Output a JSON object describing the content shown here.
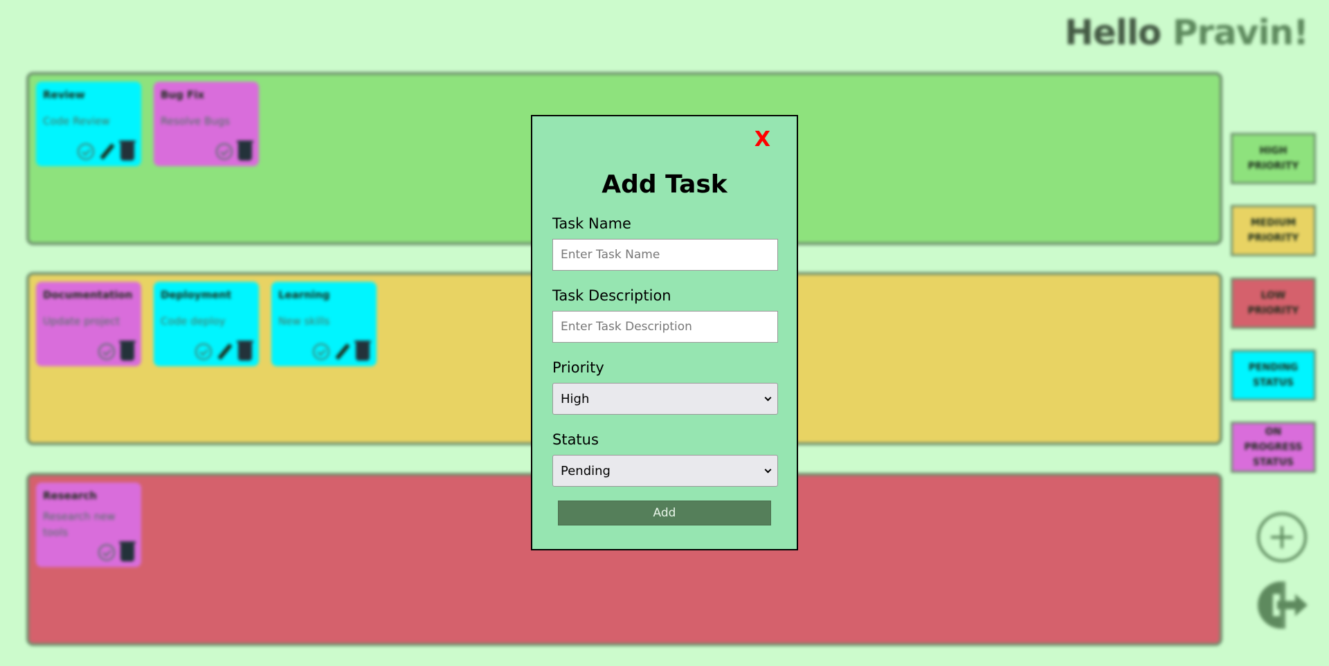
{
  "header": {
    "greeting": "Hello ",
    "user_name": "Pravin!"
  },
  "lanes": {
    "high": [
      {
        "title": "Review",
        "description": "Code Review"
      },
      {
        "title": "Bug Fix",
        "description": "Resolve Bugs"
      }
    ],
    "medium": [
      {
        "title": "Documentation",
        "description": "Update project"
      },
      {
        "title": "Deployment",
        "description": "Code deploy"
      },
      {
        "title": "Learning",
        "description": "New skills"
      }
    ],
    "low": [
      {
        "title": "Research",
        "description": "Research new tools"
      }
    ]
  },
  "sidebar": {
    "high_priority": "HIGH PRIORITY",
    "medium_priority": "MEDIUM PRIORITY",
    "low_priority": "LOW PRIORITY",
    "pending_status": "PENDING STATUS",
    "on_progress_status": "ON PROGRESS STATUS"
  },
  "modal": {
    "close_label": "X",
    "title": "Add Task",
    "task_name_label": "Task Name",
    "task_name_placeholder": "Enter Task Name",
    "task_description_label": "Task Description",
    "task_description_placeholder": "Enter Task Description",
    "priority_label": "Priority",
    "priority_selected": "High",
    "status_label": "Status",
    "status_selected": "Pending",
    "add_label": "Add"
  },
  "colors": {
    "background": "#ccfbcc",
    "high_lane": "#8ee27d",
    "medium_lane": "#e8d363",
    "low_lane": "#d5616c",
    "pending_card": "#00f5ff",
    "on_progress_card": "#d96ddb",
    "modal_bg": "#96e5b1",
    "close_red": "#ff0000",
    "add_button": "#557f5a"
  }
}
